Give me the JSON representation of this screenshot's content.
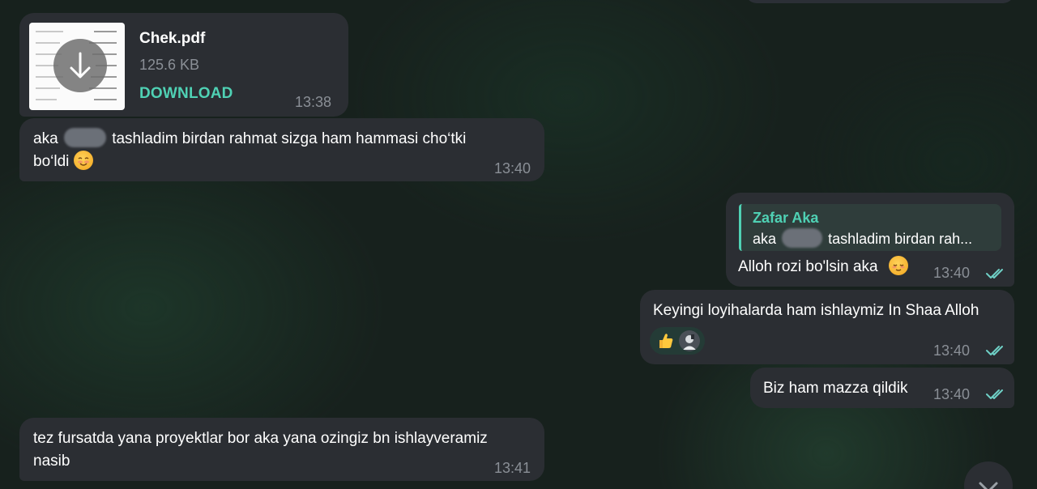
{
  "messages": {
    "file": {
      "file_name": "Chek.pdf",
      "file_size": "125.6 KB",
      "download_label": "DOWNLOAD",
      "time": "13:38",
      "icon": "download-arrow-icon"
    },
    "m1": {
      "text_before": "aka",
      "text_after": "tashladim birdan rahmat sizga ham hammasi cho‘tki",
      "text_line2": "bo‘ldi",
      "emoji": "smiling-face-emoji",
      "time": "13:40"
    },
    "m2": {
      "reply_name": "Zafar Aka",
      "reply_text_before": "aka",
      "reply_text_after": "tashladim birdan rah...",
      "text": "Alloh rozi bo'lsin aka",
      "emoji": "relieved-face-emoji",
      "time": "13:40",
      "status_icon": "double-check-icon"
    },
    "m3": {
      "text": "Keyingi loyihalarda ham ishlaymiz In Shaa Alloh",
      "reactions": [
        "thumbs-up-emoji",
        "reactor-avatar"
      ],
      "time": "13:40",
      "status_icon": "double-check-icon"
    },
    "m4": {
      "text": "Biz ham mazza qildik",
      "time": "13:40",
      "status_icon": "double-check-icon"
    },
    "m5": {
      "text_line1": "tez fursatda yana proyektlar bor aka yana ozingiz bn ishlayveramiz",
      "text_line2": "nasib",
      "time": "13:41"
    }
  },
  "scroll_button": {
    "icon": "chevron-down-icon"
  },
  "colors": {
    "accent": "#4fd1b4",
    "bubble": "#2b2e33",
    "time": "#8a8f96",
    "check": "#6fd0c6"
  }
}
